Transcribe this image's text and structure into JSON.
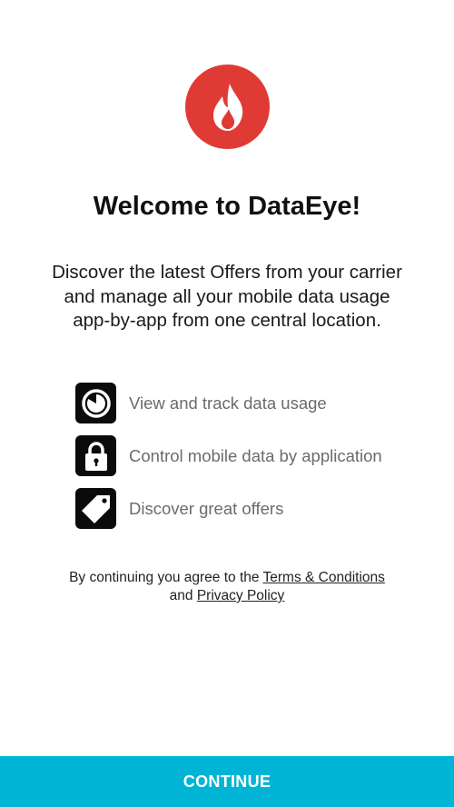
{
  "app": {
    "logo_icon": "flame-icon",
    "brand_color": "#e03a35",
    "accent_color": "#00b4d6"
  },
  "welcome": {
    "title": "Welcome to DataEye!",
    "intro": "Discover the latest Offers from your carrier and manage all your mobile data usage app-by-app from one central location."
  },
  "features": [
    {
      "icon": "pie-chart-icon",
      "label": "View and track data usage"
    },
    {
      "icon": "lock-icon",
      "label": "Control mobile data by application"
    },
    {
      "icon": "tag-icon",
      "label": "Discover great offers"
    }
  ],
  "legal": {
    "prefix": "By continuing you agree to the ",
    "terms_link": "Terms & Conditions",
    "conjunction": "and ",
    "privacy_link": "Privacy Policy"
  },
  "actions": {
    "continue_label": "CONTINUE"
  }
}
